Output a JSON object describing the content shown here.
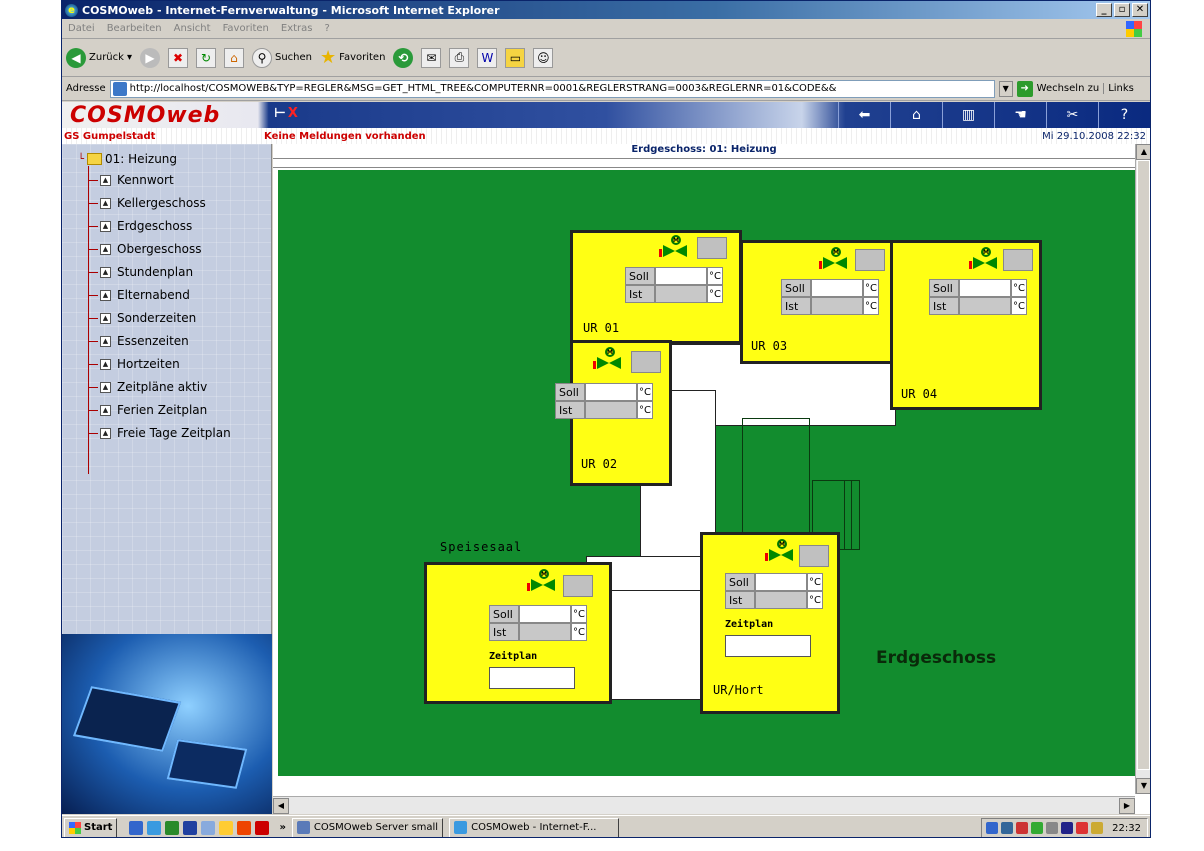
{
  "window": {
    "title": "COSMOweb - Internet-Fernverwaltung - Microsoft Internet Explorer"
  },
  "menu": [
    "Datei",
    "Bearbeiten",
    "Ansicht",
    "Favoriten",
    "Extras",
    "?"
  ],
  "toolbar": {
    "back": "Zurück",
    "search": "Suchen",
    "favorites": "Favoriten"
  },
  "address": {
    "label": "Adresse",
    "url": "http://localhost/COSMOWEB&TYP=REGLER&MSG=GET_HTML_TREE&COMPUTERNR=0001&REGLERSTRANG=0003&REGLERNR=01&CODE&&",
    "go": "Wechseln zu",
    "links": "Links"
  },
  "app": {
    "logo": "COSMOweb",
    "site": "GS Gumpelstadt",
    "message": "Keine Meldungen vorhanden",
    "datetime": "Mi 29.10.2008 22:32"
  },
  "tree": {
    "root": "01: Heizung",
    "items": [
      "Kennwort",
      "Kellergeschoss",
      "Erdgeschoss",
      "Obergeschoss",
      "Stundenplan",
      "Elternabend",
      "Sonderzeiten",
      "Essenzeiten",
      "Hortzeiten",
      "Zeitpläne aktiv",
      "Ferien Zeitplan",
      "Freie Tage Zeitplan"
    ]
  },
  "content": {
    "title": "Erdgeschoss: 01: Heizung",
    "floor_name": "Erdgeschoss",
    "speisesaal": "Speisesaal",
    "soll": "Soll",
    "ist": "Ist",
    "unit": "°C",
    "zeitplan": "Zeitplan",
    "rooms": [
      "UR 01",
      "UR 02",
      "UR 03",
      "UR 04",
      "UR/Hort"
    ],
    "valve_letter": "M"
  },
  "taskbar": {
    "start": "Start",
    "tasks": [
      "COSMOweb Server small",
      "COSMOweb - Internet-F..."
    ],
    "clock": "22:32"
  }
}
